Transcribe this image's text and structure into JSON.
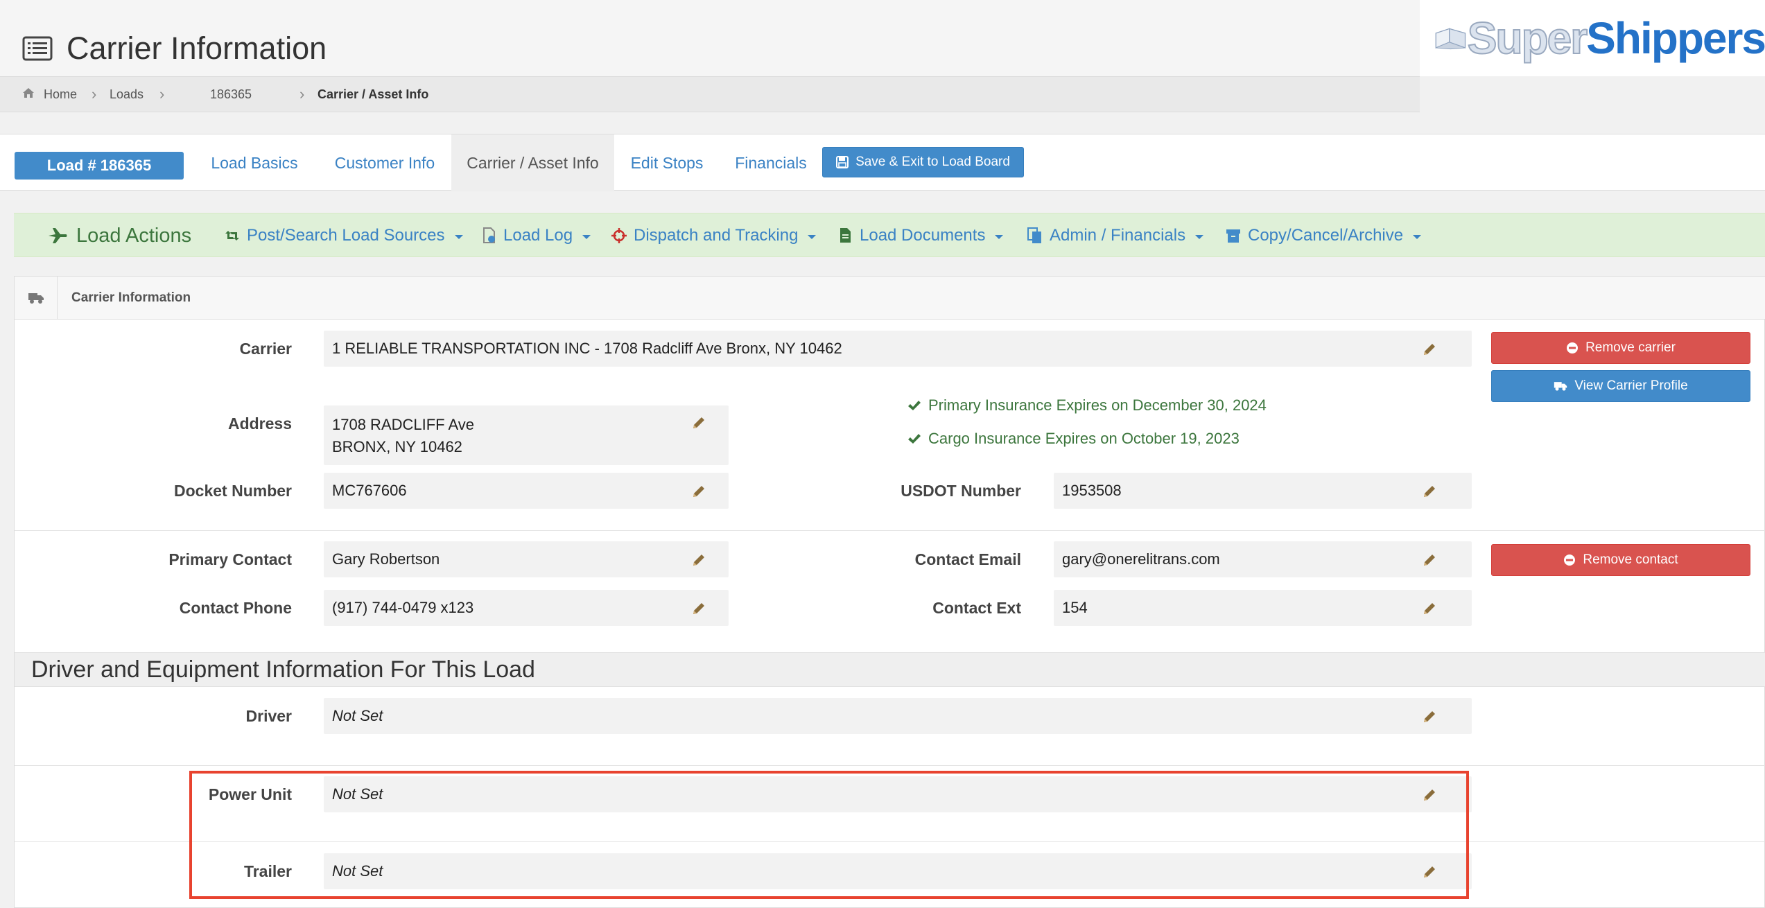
{
  "header": {
    "title": "Carrier Information"
  },
  "logo": {
    "part1": "Super",
    "part2": "Shippers"
  },
  "breadcrumb": {
    "home": "Home",
    "loads": "Loads",
    "load_id": "186365",
    "current": "Carrier / Asset Info"
  },
  "tabs": {
    "load_badge": "Load # 186365",
    "items": [
      "Load Basics",
      "Customer Info",
      "Carrier / Asset Info",
      "Edit Stops",
      "Financials"
    ],
    "save": "Save & Exit to Load Board"
  },
  "actions": {
    "title": "Load Actions",
    "items": [
      "Post/Search Load Sources",
      "Load Log",
      "Dispatch and Tracking",
      "Load Documents",
      "Admin / Financials",
      "Copy/Cancel/Archive"
    ]
  },
  "panel": {
    "title": "Carrier Information"
  },
  "carrier": {
    "label": "Carrier",
    "value": "1 RELIABLE TRANSPORTATION INC - 1708 Radcliff Ave Bronx, NY 10462",
    "remove": "Remove carrier",
    "view": "View Carrier Profile"
  },
  "address": {
    "label": "Address",
    "line1": "1708 RADCLIFF Ave",
    "line2": "BRONX, NY 10462"
  },
  "insurance": {
    "primary": "Primary Insurance Expires on December 30, 2024",
    "cargo": "Cargo Insurance Expires on October 19, 2023"
  },
  "docket": {
    "label": "Docket Number",
    "value": "MC767606"
  },
  "usdot": {
    "label": "USDOT Number",
    "value": "1953508"
  },
  "contact": {
    "primary_label": "Primary Contact",
    "primary_value": "Gary Robertson",
    "email_label": "Contact Email",
    "email_value": "gary@onerelitrans.com",
    "phone_label": "Contact Phone",
    "phone_value": "(917) 744-0479 x123",
    "ext_label": "Contact Ext",
    "ext_value": "154",
    "remove": "Remove contact"
  },
  "equipment": {
    "title": "Driver and Equipment Information For This Load",
    "driver_label": "Driver",
    "driver_value": "Not Set",
    "power_label": "Power Unit",
    "power_value": "Not Set",
    "trailer_label": "Trailer",
    "trailer_value": "Not Set"
  },
  "colors": {
    "primary": "#428bca",
    "danger": "#d9534f",
    "success_bg": "#dff0d8",
    "success_text": "#3c763d",
    "highlight": "#e8432f"
  }
}
